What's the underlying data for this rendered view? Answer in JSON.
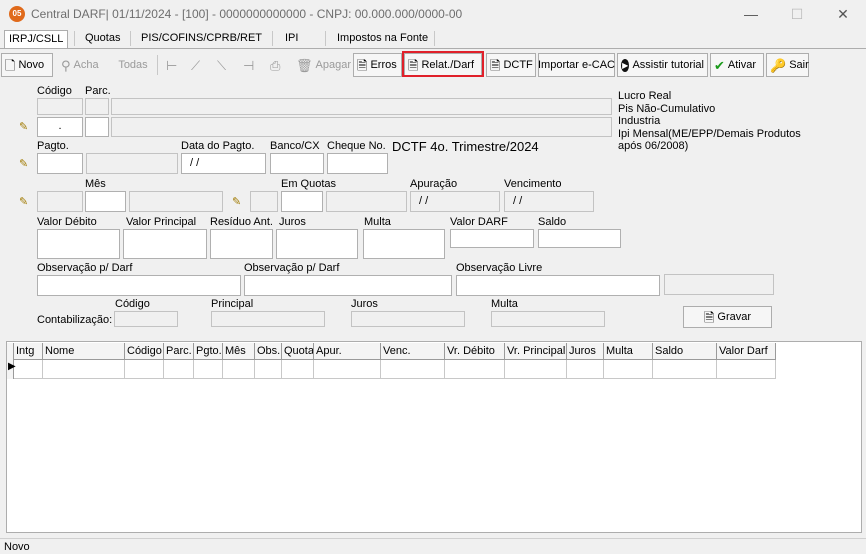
{
  "window": {
    "logo_text": "05",
    "title": "Central DARF|  01/11/2024 - [100] - 0000000000000 - CNPJ: 00.000.000/0000-00",
    "min_glyph": "—",
    "max_glyph": "☐",
    "close_glyph": "✕"
  },
  "tabs": [
    {
      "label": "IRPJ/CSLL",
      "active": true
    },
    {
      "label": "Quotas",
      "active": false
    },
    {
      "label": "PIS/COFINS/CPRB/RET",
      "active": false
    },
    {
      "label": "IPI",
      "active": false
    },
    {
      "label": "Impostos na Fonte",
      "active": false
    }
  ],
  "toolbar": {
    "novo": "Novo",
    "acha": "Acha",
    "todas": "Todas",
    "apagar": "Apagar",
    "erros": "Erros",
    "relat_darf": "Relat./Darf",
    "dctf": "DCTF",
    "importar_ecac": "Importar e-CAC",
    "assistir_tutorial": "Assistir tutorial",
    "ativar": "Ativar",
    "sair": "Sair",
    "highlight_color": "#e0202a"
  },
  "form": {
    "codigo_label": "Código",
    "parc_label": "Parc.",
    "codigo_value": ".",
    "pagto_label": "Pagto.",
    "data_pagto_label": "Data do Pagto.",
    "data_pagto_value": "/ /",
    "banco_label": "Banco/CX",
    "cheque_label": "Cheque No.",
    "dctf_period": "DCTF 4o. Trimestre/2024",
    "mes_label": "Mês",
    "em_quotas_label": "Em Quotas",
    "apuracao_label": "Apuração",
    "apuracao_value": "/ /",
    "vencimento_label": "Vencimento",
    "vencimento_value": "/ /",
    "valor_debito_label": "Valor Débito",
    "valor_principal_label": "Valor Principal",
    "residuo_label": "Resíduo Ant.",
    "juros_label": "Juros",
    "multa_label": "Multa",
    "valor_darf_label": "Valor DARF",
    "saldo_label": "Saldo",
    "obs_darf_label_1": "Observação p/ Darf",
    "obs_darf_label_2": "Observação p/ Darf",
    "obs_livre_label": "Observação Livre",
    "contab_label": "Contabilização:",
    "contab_codigo_label": "Código",
    "contab_principal_label": "Principal",
    "contab_juros_label": "Juros",
    "contab_multa_label": "Multa",
    "gravar": "Gravar"
  },
  "info": {
    "lines": [
      "Lucro Real",
      "Pis Não-Cumulativo",
      "Industria",
      "Ipi Mensal(ME/EPP/Demais Produtos",
      "após 06/2008)"
    ]
  },
  "grid": {
    "columns": [
      "Intg",
      "Nome",
      "Código",
      "Parc.",
      "Pgto.",
      "Mês",
      "Obs.",
      "Quota",
      "Apur.",
      "Venc.",
      "Vr. Débito",
      "Vr. Principal",
      "Juros",
      "Multa",
      "Saldo",
      "Valor Darf"
    ],
    "row_indicator": "▶"
  },
  "status": {
    "text": "Novo"
  }
}
